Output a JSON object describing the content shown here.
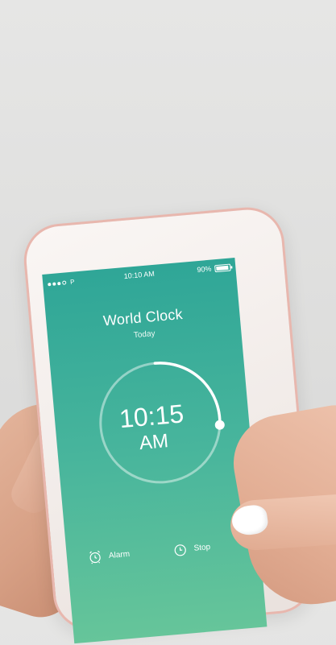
{
  "status_bar": {
    "carrier": "P",
    "time": "10:10 AM",
    "battery": "90%",
    "battery_level": 0.9
  },
  "clock": {
    "title": "World Clock",
    "subtitle": "Today",
    "time": "10:15",
    "ampm": "AM",
    "arc_progress": 0.27
  },
  "tabs": [
    {
      "label": "Alarm",
      "icon": "alarm-clock-icon"
    },
    {
      "label": "Stop",
      "icon": "stopwatch-icon"
    }
  ],
  "colors": {
    "screen_top": "#2fa697",
    "screen_bottom": "#66c59a",
    "phone_frame": "#e8b7ae",
    "background": "#e3e3e2"
  }
}
